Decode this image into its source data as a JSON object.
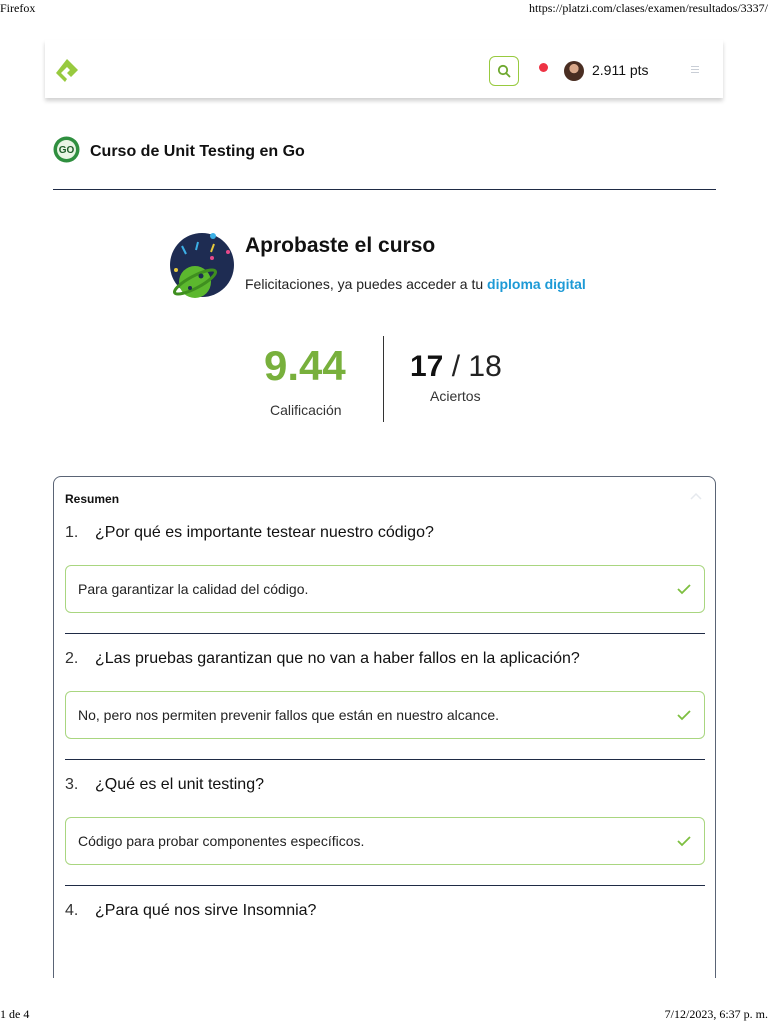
{
  "print": {
    "browser": "Firefox",
    "url": "https://platzi.com/clases/examen/resultados/3337/",
    "page_indicator": "1 de 4",
    "timestamp": "7/12/2023, 6:37 p. m."
  },
  "navbar": {
    "logo_icon": "platzi-logo-icon",
    "search_icon": "search-icon",
    "points": "2.911 pts",
    "menu_icon": "hamburger-icon",
    "accent": "#98ca3f"
  },
  "course": {
    "badge_text": "GO",
    "title": "Curso de Unit Testing en Go"
  },
  "result": {
    "title": "Aprobaste el curso",
    "subtitle": "Felicitaciones, ya puedes acceder a tu ",
    "link": "diploma digital",
    "grade": "9.44",
    "grade_label": "Calificación",
    "correct": "17",
    "separator": " / ",
    "total": "18",
    "correct_label": "Aciertos"
  },
  "summary": {
    "title": "Resumen",
    "questions": [
      {
        "num": "1.",
        "text": "¿Por qué es importante testear nuestro código?",
        "answer": "Para garantizar la calidad del código."
      },
      {
        "num": "2.",
        "text": "¿Las pruebas garantizan que no van a haber fallos en la aplicación?",
        "answer": "No, pero nos permiten prevenir fallos que están en nuestro alcance."
      },
      {
        "num": "3.",
        "text": "¿Qué es el unit testing?",
        "answer": "Código para probar componentes específicos."
      },
      {
        "num": "4.",
        "text": "¿Para qué nos sirve Insomnia?",
        "answer": ""
      }
    ]
  }
}
